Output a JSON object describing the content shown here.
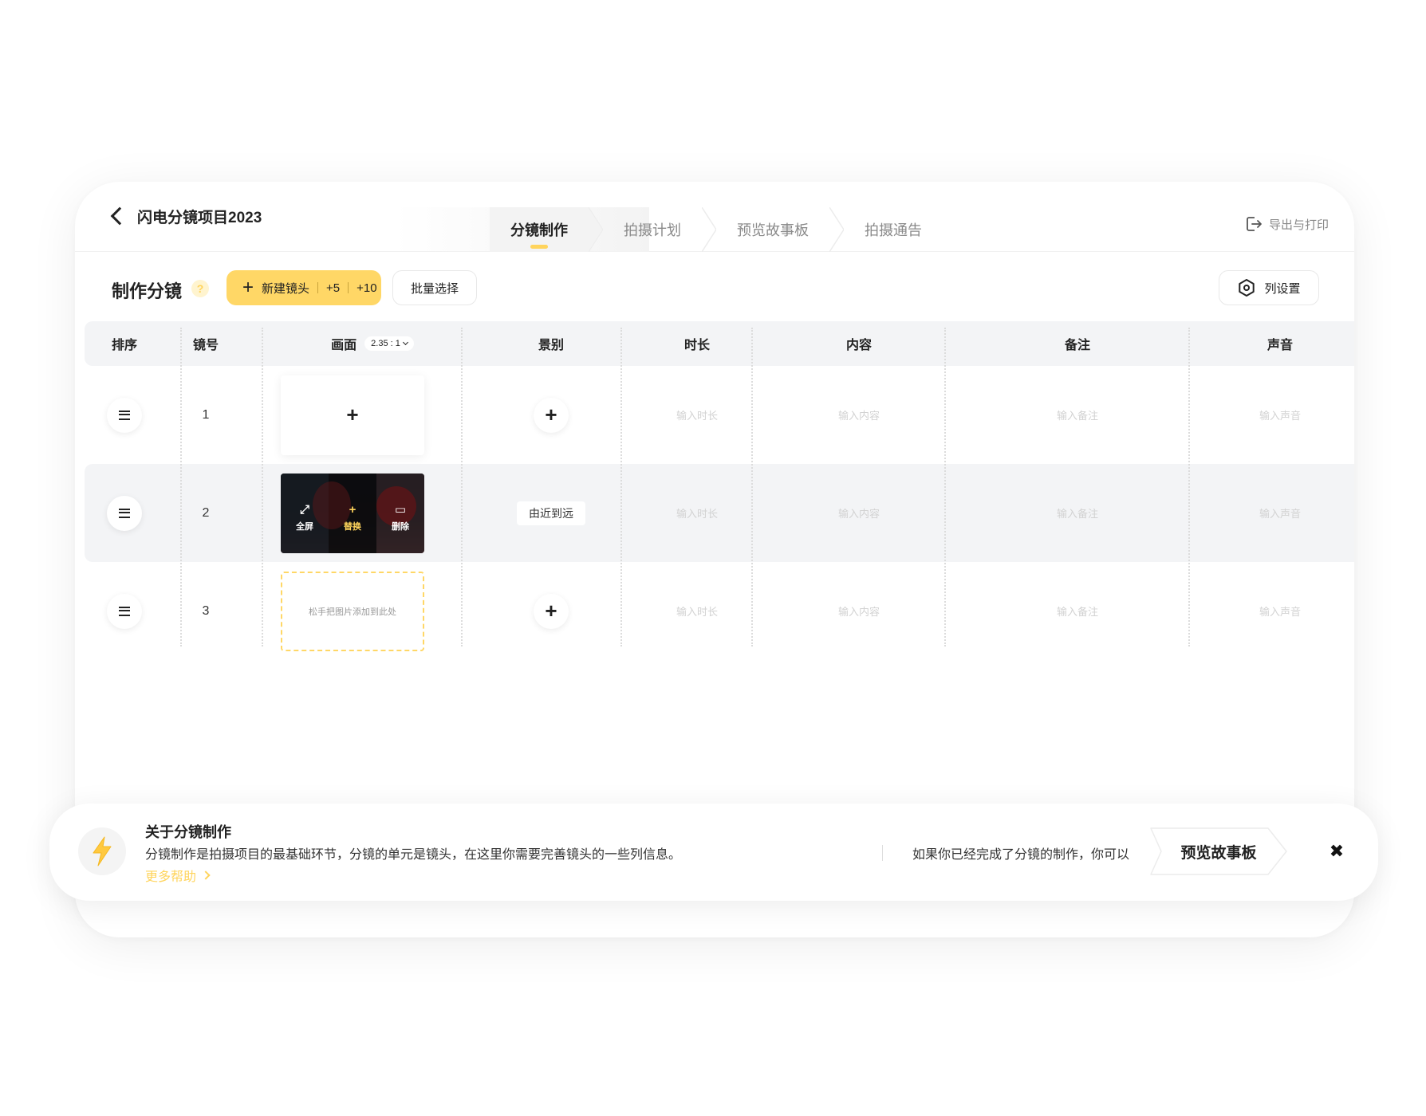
{
  "header": {
    "project_title": "闪电分镜项目2023",
    "tabs": [
      {
        "label": "分镜制作",
        "active": true
      },
      {
        "label": "拍摄计划",
        "active": false
      },
      {
        "label": "预览故事板",
        "active": false
      },
      {
        "label": "拍摄通告",
        "active": false
      }
    ],
    "export_label": "导出与打印"
  },
  "toolbar": {
    "section_title": "制作分镜",
    "help_glyph": "?",
    "new_shot_label": "新建镜头",
    "add_five_label": "+5",
    "add_ten_label": "+10",
    "batch_select_label": "批量选择",
    "column_settings_label": "列设置"
  },
  "table": {
    "columns": {
      "sort": "排序",
      "shot_number": "镜号",
      "frame": "画面",
      "aspect_ratio": "2.35 : 1",
      "scene": "景别",
      "duration": "时长",
      "content": "内容",
      "notes": "备注",
      "sound": "声音"
    },
    "placeholders": {
      "duration": "输入时长",
      "content": "输入内容",
      "notes": "输入备注",
      "sound": "输入声音"
    },
    "rows": [
      {
        "number": "1"
      },
      {
        "number": "2",
        "scene": "由近到远",
        "image_actions": {
          "fullscreen": "全屏",
          "replace": "替换",
          "delete": "删除"
        }
      },
      {
        "number": "3",
        "drop_hint": "松手把图片添加到此处"
      }
    ]
  },
  "banner": {
    "title": "关于分镜制作",
    "description": "分镜制作是拍摄项目的最基础环节，分镜的单元是镜头，在这里你需要完善镜头的一些列信息。",
    "help_link": "更多帮助",
    "prompt": "如果你已经完成了分镜的制作，你可以",
    "cta_label": "预览故事板",
    "close_glyph": "✖"
  },
  "colors": {
    "accent": "#ffd766",
    "accent_text": "#ffd45c",
    "row_alt_bg": "#f3f4f6",
    "placeholder": "#d2d2d2"
  }
}
